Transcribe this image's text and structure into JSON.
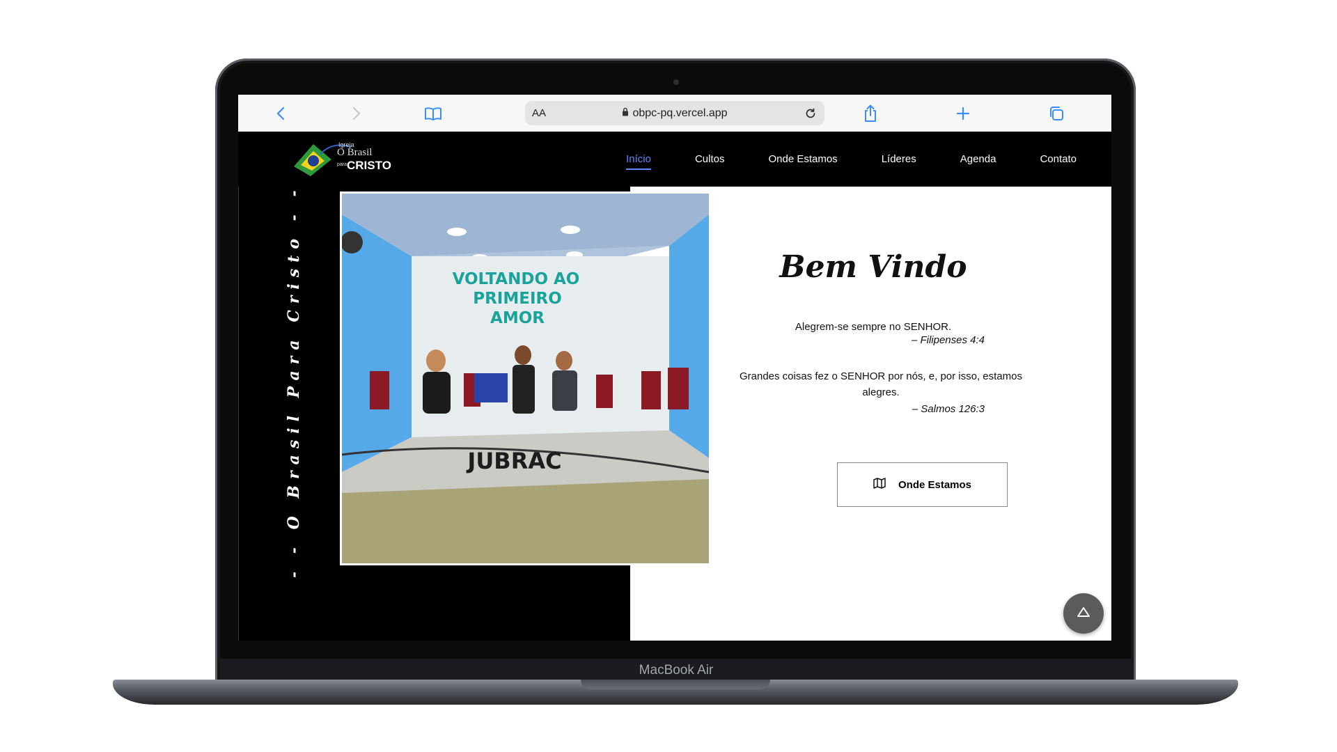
{
  "device": {
    "model_label": "MacBook Air"
  },
  "browser": {
    "url": "obpc-pq.vercel.app",
    "text_size_label": "AA",
    "icons": [
      "back-icon",
      "forward-icon",
      "bookmarks-icon",
      "lock-icon",
      "reload-icon",
      "share-icon",
      "new-tab-icon",
      "tabs-icon"
    ]
  },
  "site": {
    "logo": {
      "line1": "Igreja",
      "line2": "O Brasil",
      "line3": "para",
      "line4": "CRISTO"
    },
    "nav": [
      {
        "label": "Início",
        "active": true
      },
      {
        "label": "Cultos",
        "active": false
      },
      {
        "label": "Onde Estamos",
        "active": false
      },
      {
        "label": "Líderes",
        "active": false
      },
      {
        "label": "Agenda",
        "active": false
      },
      {
        "label": "Contato",
        "active": false
      }
    ],
    "vertical_text": "- - O Brasil Para Cristo - -",
    "photo": {
      "banner_line1": "VOLTANDO AO",
      "banner_line2": "PRIMEIRO",
      "banner_line3": "AMOR",
      "stage_text": "JUBRAC"
    },
    "welcome_title": "Bem Vindo",
    "verses": [
      {
        "text": "Alegrem-se sempre no SENHOR.",
        "ref": "– Filipenses 4:4"
      },
      {
        "text": "Grandes coisas fez o SENHOR por nós, e, por isso, estamos alegres.",
        "ref": "– Salmos 126:3"
      }
    ],
    "cta_label": "Onde Estamos",
    "colors": {
      "accent": "#5f8bff",
      "background": "#000000",
      "panel": "#ffffff"
    }
  }
}
